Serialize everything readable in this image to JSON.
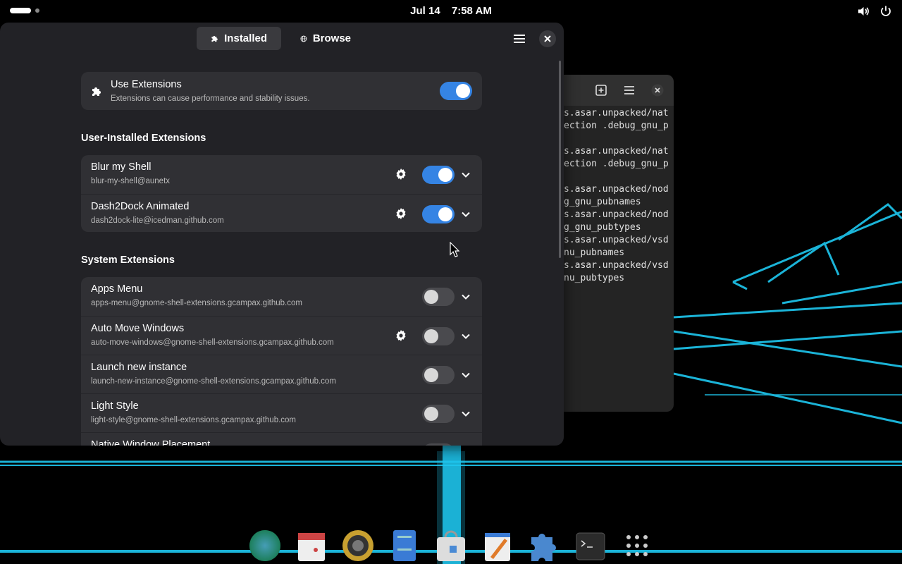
{
  "topbar": {
    "date": "Jul 14",
    "time": "7:58 AM",
    "icons": [
      "volume-icon",
      "power-icon"
    ]
  },
  "app": {
    "tabs": [
      {
        "label": "Installed",
        "icon": "puzzle-icon",
        "active": true
      },
      {
        "label": "Browse",
        "icon": "globe-icon",
        "active": false
      }
    ],
    "use_extensions": {
      "title": "Use Extensions",
      "subtitle": "Extensions can cause performance and stability issues.",
      "enabled": true
    },
    "user_section_title": "User-Installed Extensions",
    "user_extensions": [
      {
        "name": "Blur my Shell",
        "uuid": "blur-my-shell@aunetx",
        "settings": true,
        "enabled": true
      },
      {
        "name": "Dash2Dock Animated",
        "uuid": "dash2dock-lite@icedman.github.com",
        "settings": true,
        "enabled": true
      }
    ],
    "system_section_title": "System Extensions",
    "system_extensions": [
      {
        "name": "Apps Menu",
        "uuid": "apps-menu@gnome-shell-extensions.gcampax.github.com",
        "settings": false,
        "enabled": false
      },
      {
        "name": "Auto Move Windows",
        "uuid": "auto-move-windows@gnome-shell-extensions.gcampax.github.com",
        "settings": true,
        "enabled": false
      },
      {
        "name": "Launch new instance",
        "uuid": "launch-new-instance@gnome-shell-extensions.gcampax.github.com",
        "settings": false,
        "enabled": false
      },
      {
        "name": "Light Style",
        "uuid": "light-style@gnome-shell-extensions.gcampax.github.com",
        "settings": false,
        "enabled": false
      },
      {
        "name": "Native Window Placement",
        "uuid": "",
        "settings": false,
        "enabled": false
      }
    ],
    "accent_color": "#3584e4"
  },
  "terminal": {
    "lines": [
      "s.asar.unpacked/nat",
      "ection .debug_gnu_p",
      "",
      "s.asar.unpacked/nat",
      "ection .debug_gnu_p",
      "",
      "s.asar.unpacked/nod",
      "g_gnu_pubnames",
      "s.asar.unpacked/nod",
      "g_gnu_pubtypes",
      "s.asar.unpacked/vsd",
      "nu_pubnames",
      "s.asar.unpacked/vsd",
      "nu_pubtypes"
    ]
  },
  "dock": {
    "items": [
      "browser-icon",
      "calendar-icon",
      "music-player-icon",
      "files-icon",
      "software-icon",
      "text-editor-icon",
      "extensions-icon",
      "terminal-icon",
      "app-grid-icon"
    ]
  }
}
